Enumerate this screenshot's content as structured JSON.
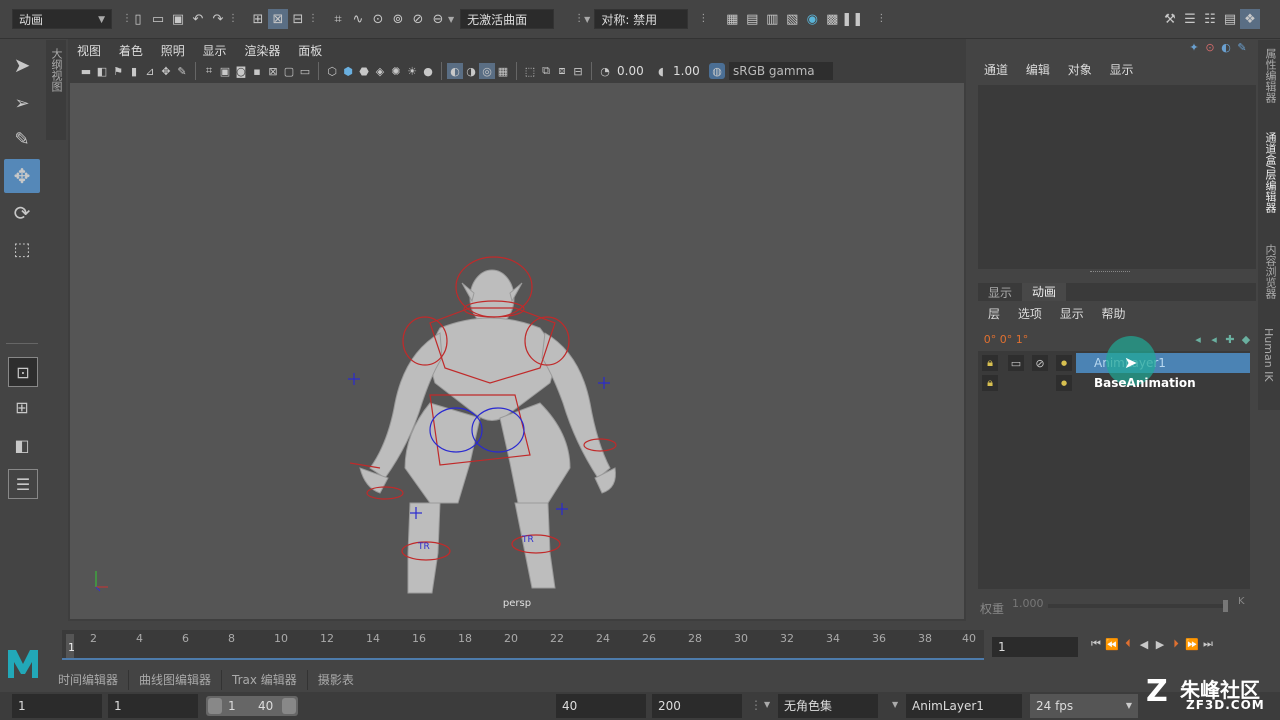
{
  "top_toolbar": {
    "mode_dropdown": "动画",
    "live_surface": "无激活曲面",
    "symmetry": "对称: 禁用"
  },
  "left_tabs": {
    "outliner": "大纲视图"
  },
  "viewport": {
    "menu": [
      "视图",
      "着色",
      "照明",
      "显示",
      "渲染器",
      "面板"
    ],
    "exposure": "0.00",
    "gamma": "1.00",
    "color_space": "sRGB gamma",
    "camera_label": "persp",
    "control_labels": [
      "TR",
      "TR"
    ]
  },
  "channel_box": {
    "menu": [
      "通道",
      "编辑",
      "对象",
      "显示"
    ]
  },
  "right_side_tabs": [
    "属性编辑器",
    "通道盒/层编辑器",
    "内容浏览器",
    "Human IK"
  ],
  "layer_editor": {
    "tabs": [
      "显示",
      "动画"
    ],
    "menu": [
      "层",
      "选项",
      "显示",
      "帮助"
    ],
    "layers": [
      {
        "name": "AnimLayer1",
        "selected": true
      },
      {
        "name": "BaseAnimation",
        "selected": false
      }
    ],
    "weight_label": "权重",
    "weight_value": "1.000",
    "key_label": "K"
  },
  "timeline": {
    "ticks": [
      "1",
      "2",
      "4",
      "6",
      "8",
      "10",
      "12",
      "14",
      "16",
      "18",
      "20",
      "22",
      "24",
      "26",
      "28",
      "30",
      "32",
      "34",
      "36",
      "38",
      "40"
    ],
    "current_frame": "1"
  },
  "bottom_tabs": [
    "时间编辑器",
    "曲线图编辑器",
    "Trax 编辑器",
    "摄影表"
  ],
  "range": {
    "start": "1",
    "playback_start": "1",
    "slider_start": "1",
    "slider_end": "40",
    "playback_end": "40",
    "end": "200",
    "character_set": "无角色集",
    "anim_layer": "AnimLayer1",
    "fps": "24 fps"
  },
  "watermark": {
    "line1": "朱峰社区",
    "line2": "ZF3D.COM"
  },
  "colors": {
    "accent": "#4d7bab",
    "selected_layer": "#4b83b4",
    "viewport_bg": "#555555",
    "rig_red": "#c02a2a",
    "rig_blue": "#2a2ad0"
  }
}
